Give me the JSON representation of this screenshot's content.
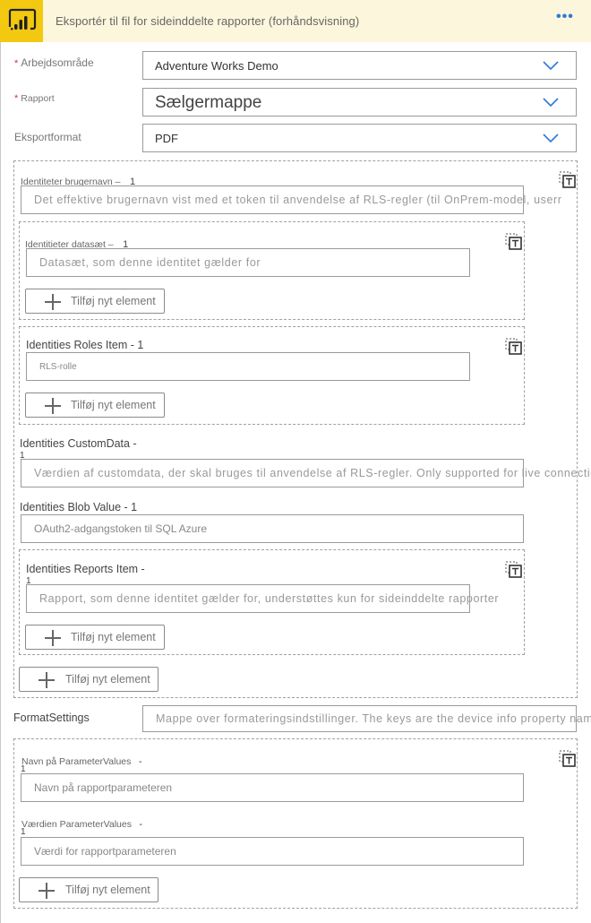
{
  "header": {
    "title": "Eksportér til fil for sideinddelte rapporter (forhåndsvisning)",
    "more_label": "•••",
    "logo_icon": "power-bi-icon",
    "brand_color": "#f2c811",
    "header_bg": "#fcf6dc",
    "accent_color": "#2b79d8"
  },
  "fields": {
    "workspace": {
      "required_mark": "*",
      "label": "Arbejdsområde",
      "value": "Adventure Works Demo"
    },
    "report": {
      "required_mark": "*",
      "label": "Rapport",
      "value": "Sælgermappe"
    },
    "export_format": {
      "label": "Eksportformat",
      "value": "PDF"
    }
  },
  "identities": {
    "username": {
      "label": "Identiteter brugernavn –",
      "index": "1",
      "placeholder": "Det effektive brugernavn vist med et token til anvendelse af RLS-regler (til OnPrem-model, userr"
    },
    "datasets": {
      "label": "Identitieter datasæt –",
      "index": "1",
      "placeholder": "Datasæt, som denne identitet gælder for",
      "add_label": "Tilføj nyt element"
    },
    "roles": {
      "label": "Identities Roles Item - 1",
      "placeholder": "RLS-rolle",
      "add_label": "Tilføj nyt element"
    },
    "custom_data": {
      "label": "Identities CustomData -",
      "index": "1",
      "placeholder": "Værdien af customdata, der skal bruges til anvendelse af RLS-regler. Only supported for live connectic"
    },
    "blob_value": {
      "label": "Identities Blob Value - 1",
      "placeholder": "OAuth2-adgangstoken til SQL Azure"
    },
    "reports": {
      "label": "Identities Reports Item -",
      "index": "1",
      "placeholder": "Rapport, som denne identitet gælder for, understøttes kun for sideinddelte rapporter",
      "add_label": "Tilføj nyt element"
    },
    "add_label": "Tilføj nyt element"
  },
  "format_settings": {
    "label": "FormatSettings",
    "placeholder": "Mappe over formateringsindstillinger. The keys are the device info property names"
  },
  "parameter_values": {
    "name": {
      "label": "Navn på ParameterValues",
      "dash": "-",
      "index": "1",
      "placeholder": "Navn på rapportparameteren"
    },
    "value": {
      "label": "Værdien ParameterValues",
      "dash": "-",
      "index": "1",
      "placeholder": "Værdi for rapportparameteren"
    },
    "add_label": "Tilføj nyt element"
  }
}
